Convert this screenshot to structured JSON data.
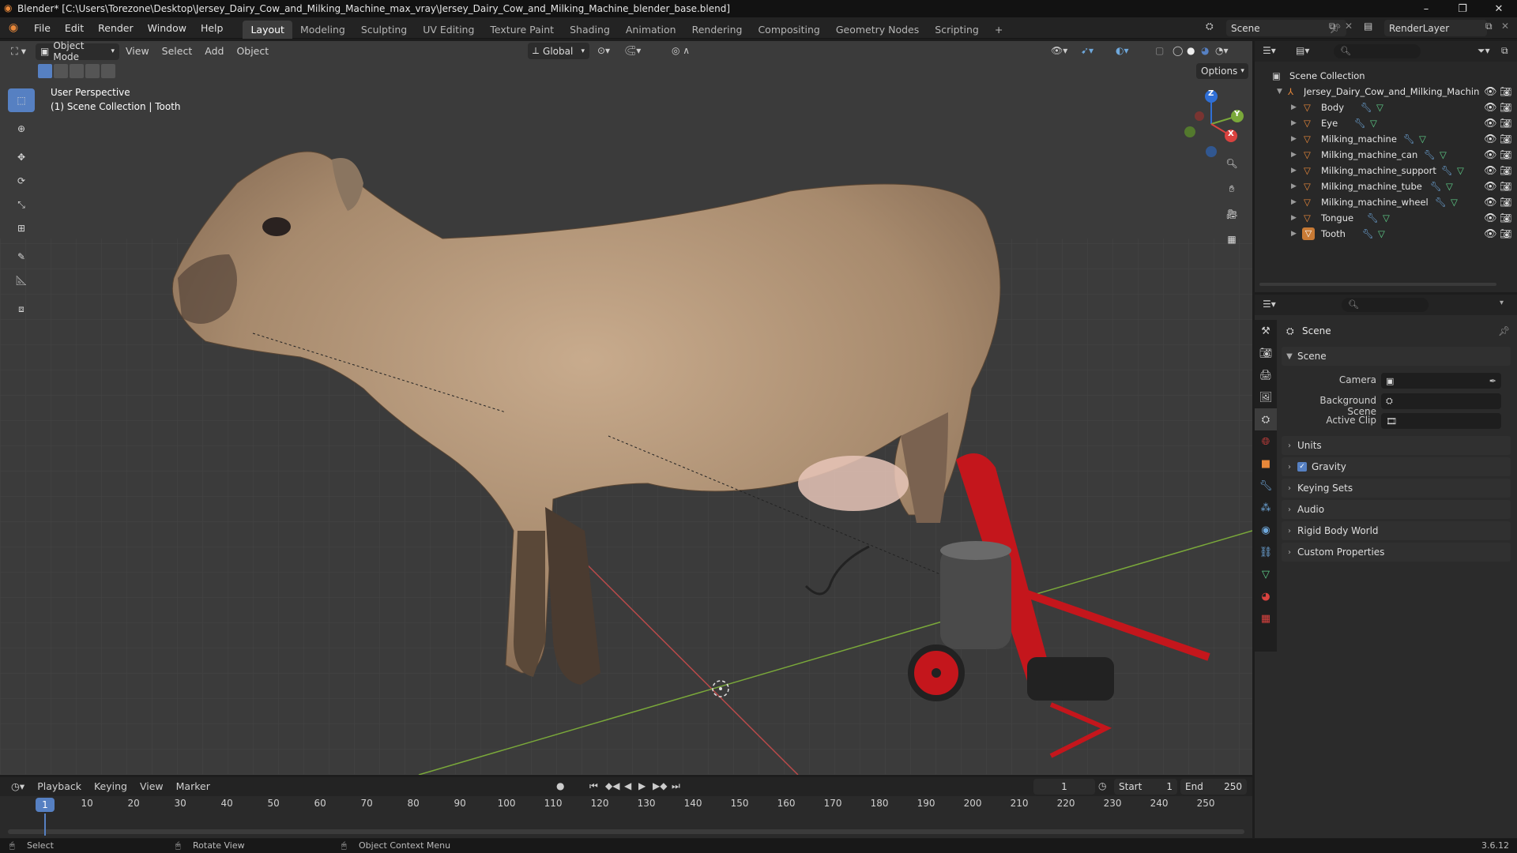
{
  "titlebar": {
    "title": "Blender* [C:\\Users\\Torezone\\Desktop\\Jersey_Dairy_Cow_and_Milking_Machine_max_vray\\Jersey_Dairy_Cow_and_Milking_Machine_blender_base.blend]",
    "minimize": "–",
    "restore": "❐",
    "close": "✕"
  },
  "menubar": {
    "items": [
      "File",
      "Edit",
      "Render",
      "Window",
      "Help"
    ],
    "workspaces": [
      "Layout",
      "Modeling",
      "Sculpting",
      "UV Editing",
      "Texture Paint",
      "Shading",
      "Animation",
      "Rendering",
      "Compositing",
      "Geometry Nodes",
      "Scripting"
    ],
    "active_workspace": "Layout",
    "add_tab": "+",
    "scene": "Scene",
    "view_layer": "RenderLayer"
  },
  "viewport": {
    "mode": "Object Mode",
    "menus": [
      "View",
      "Select",
      "Add",
      "Object"
    ],
    "orientation": "Global",
    "options": "Options",
    "overlay_line1": "User Perspective",
    "overlay_line2": "(1) Scene Collection | Tooth",
    "gizmo": {
      "z": "Z",
      "y": "Y",
      "x": "X"
    }
  },
  "outliner": {
    "root": "Scene Collection",
    "collection": "Jersey_Dairy_Cow_and_Milking_Machine",
    "objects": [
      "Body",
      "Eye",
      "Milking_machine",
      "Milking_machine_can",
      "Milking_machine_support",
      "Milking_machine_tube",
      "Milking_machine_wheel",
      "Tongue",
      "Tooth"
    ]
  },
  "properties": {
    "context": "Scene",
    "panel": "Scene",
    "camera_label": "Camera",
    "background_scene_label": "Background Scene",
    "active_clip_label": "Active Clip",
    "sections": [
      "Units",
      "Gravity",
      "Keying Sets",
      "Audio",
      "Rigid Body World",
      "Custom Properties"
    ],
    "gravity_checked": true
  },
  "timeline": {
    "menus": [
      "Playback",
      "Keying",
      "View",
      "Marker"
    ],
    "current_frame": "1",
    "start_label": "Start",
    "start": "1",
    "end_label": "End",
    "end": "250",
    "ticks": [
      "1",
      "10",
      "20",
      "30",
      "40",
      "50",
      "60",
      "70",
      "80",
      "90",
      "100",
      "110",
      "120",
      "130",
      "140",
      "150",
      "160",
      "170",
      "180",
      "190",
      "200",
      "210",
      "220",
      "230",
      "240",
      "250"
    ]
  },
  "statusbar": {
    "select": "Select",
    "rotate": "Rotate View",
    "context_menu": "Object Context Menu",
    "version": "3.6.12"
  },
  "colors": {
    "accent": "#5680c2",
    "object_orange": "#e8883a",
    "modifier_blue": "#6fa8dc",
    "mesh_green": "#5fcf8a",
    "cow": "#b89a7c",
    "machine_red": "#c4161c"
  }
}
